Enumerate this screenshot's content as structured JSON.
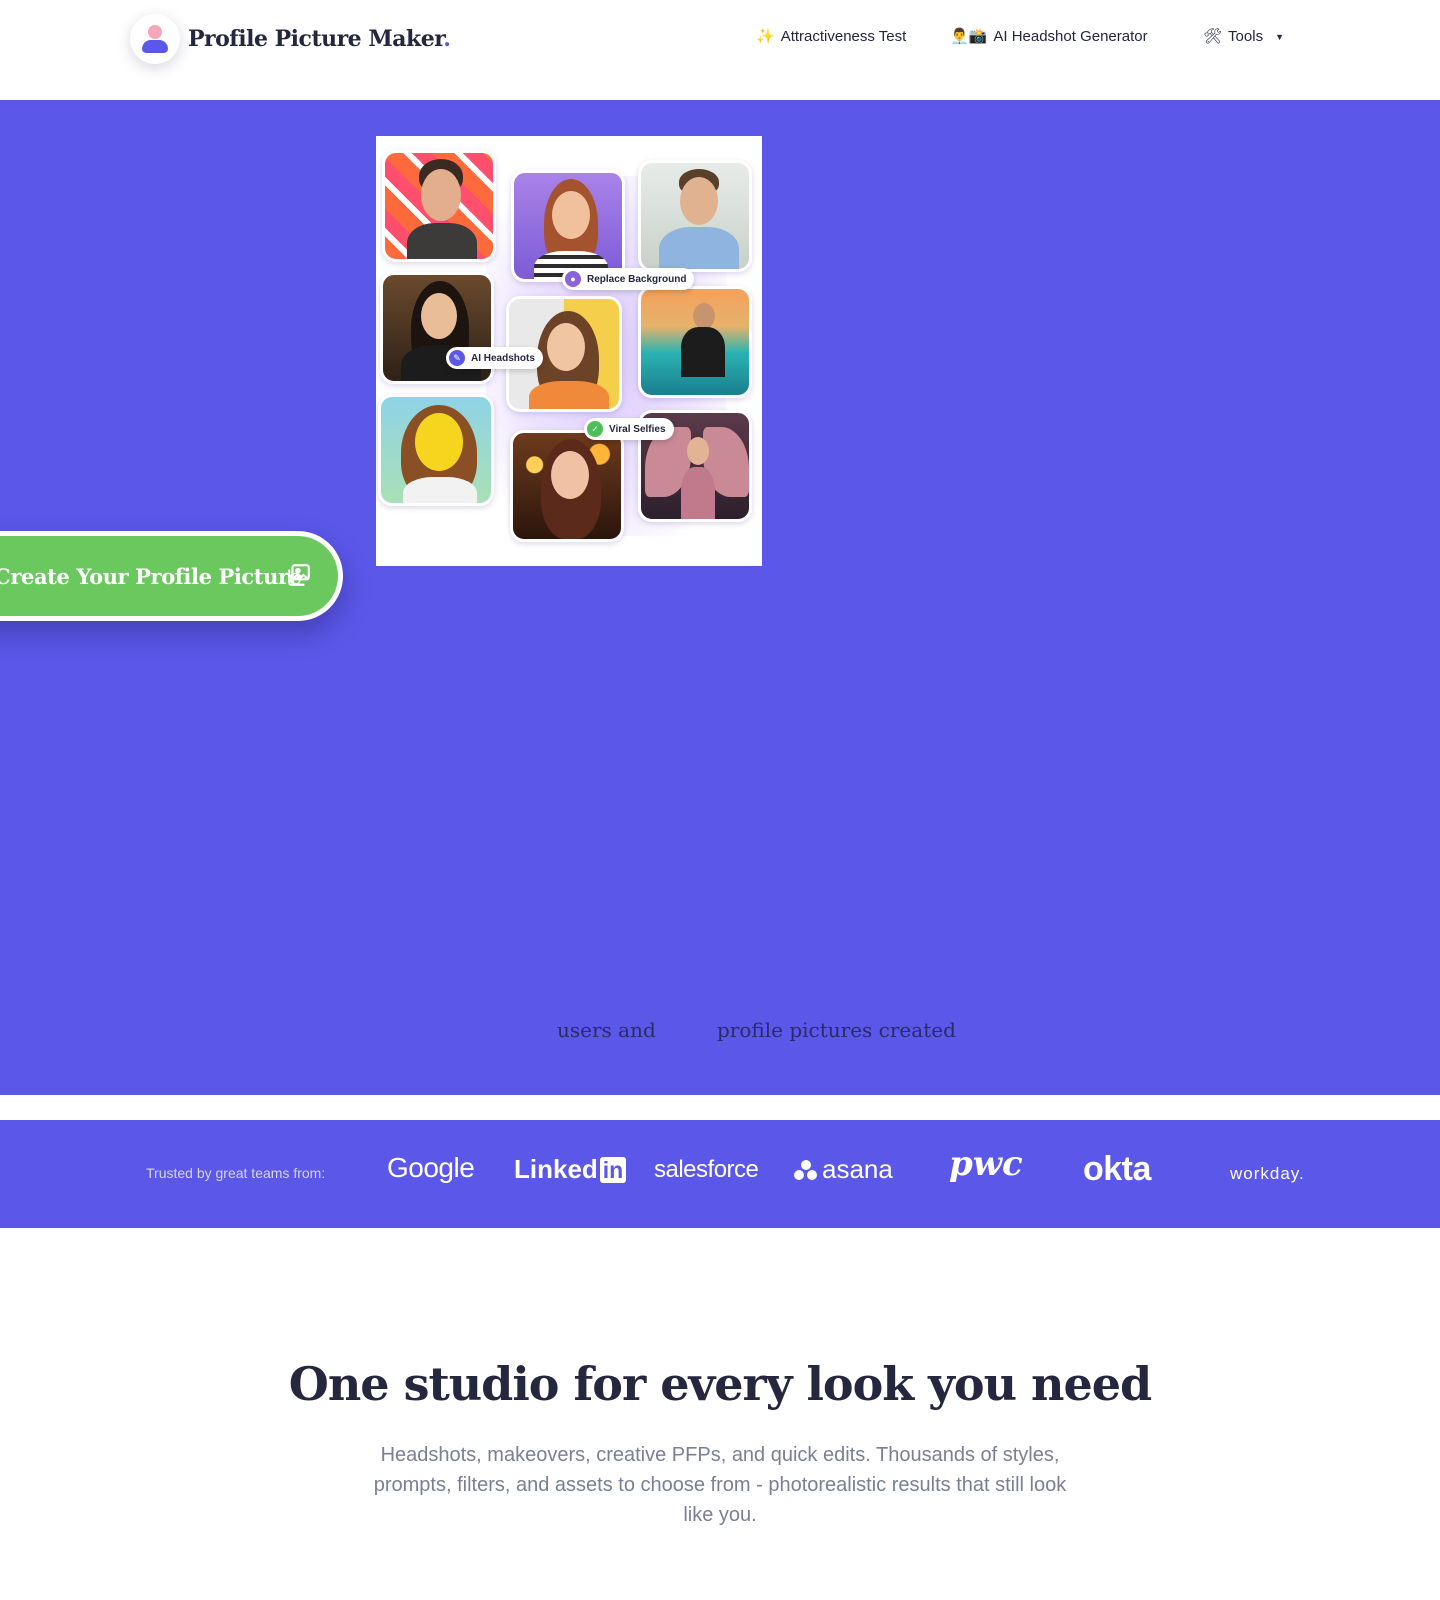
{
  "header": {
    "logo_text": "Profile Picture Maker",
    "logo_dot": ".",
    "nav": [
      {
        "icon": "sparkles-icon",
        "glyph": "✨",
        "label": "Attractiveness Test"
      },
      {
        "icon": "headshot-icon",
        "glyph": "👨‍💼📸",
        "label": "AI Headshot Generator"
      },
      {
        "icon": "tools-icon",
        "glyph": "🛠",
        "label": "Tools"
      }
    ]
  },
  "hero": {
    "collage_badges": [
      {
        "icon": "replace-background-icon",
        "label": "Replace Background"
      },
      {
        "icon": "ai-headshots-icon",
        "label": "AI Headshots"
      },
      {
        "icon": "viral-selfies-icon",
        "label": "Viral Selfies"
      }
    ],
    "cta_label": "Create Your Profile Picture",
    "stats_users_text": "users and",
    "stats_pictures_text": "profile pictures created"
  },
  "trusted": {
    "label": "Trusted by great teams from:",
    "brands": [
      "Google",
      "Linked",
      "in",
      "salesforce",
      "asana",
      "pwc",
      "okta",
      "workday."
    ]
  },
  "features": {
    "title": "One studio for every look you need",
    "subtitle": "Headshots, makeovers, creative PFPs, and quick edits. Thousands of styles, prompts, filters, and assets to choose from - photorealistic results that still look like you."
  },
  "colors": {
    "brand_purple": "#5b57e8",
    "cta_green": "#6bc85e",
    "heading_dark": "#24273e",
    "muted_text": "#7a7f96"
  }
}
